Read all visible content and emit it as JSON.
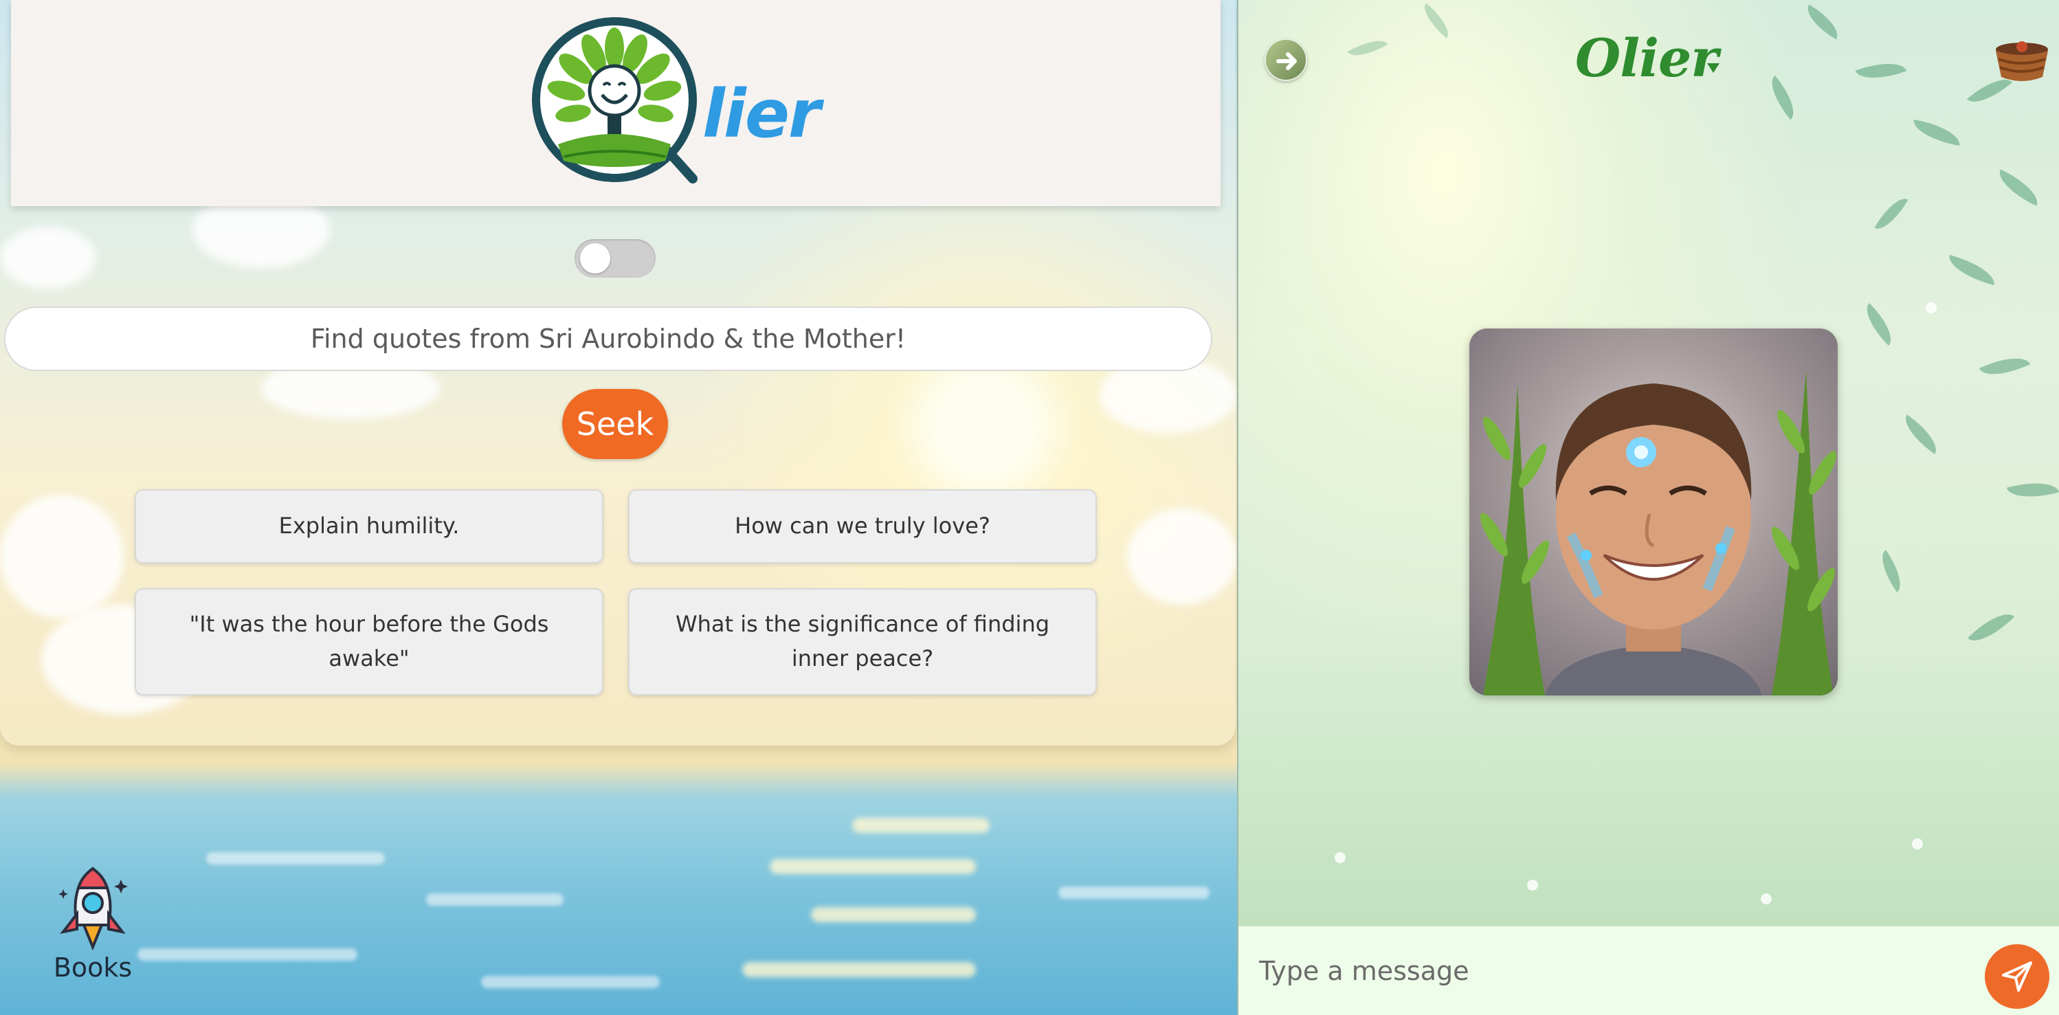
{
  "brand": {
    "logo_text": "lier",
    "logo_alt": "Olier logo"
  },
  "search": {
    "placeholder": "Find quotes from Sri Aurobindo & the Mother!",
    "button_label": "Seek",
    "toggle_on": false
  },
  "suggestions": [
    {
      "label": "Explain humility."
    },
    {
      "label": "How can we truly love?"
    },
    {
      "label": "\"It was the hour before the Gods awake\""
    },
    {
      "label": "What is the significance of finding inner peace?"
    }
  ],
  "nav": {
    "books_label": "Books",
    "books_icon": "rocket-icon"
  },
  "chat": {
    "bot_name": "Olier",
    "back_icon": "arrow-right-icon",
    "basket_icon": "basket-icon",
    "message_placeholder": "Type a message",
    "send_icon": "send-icon"
  },
  "colors": {
    "accent_orange": "#f06a24",
    "logo_blue": "#2f9be3",
    "bot_name_green": "#2f8c2f",
    "composer_bg": "#eefde9"
  }
}
